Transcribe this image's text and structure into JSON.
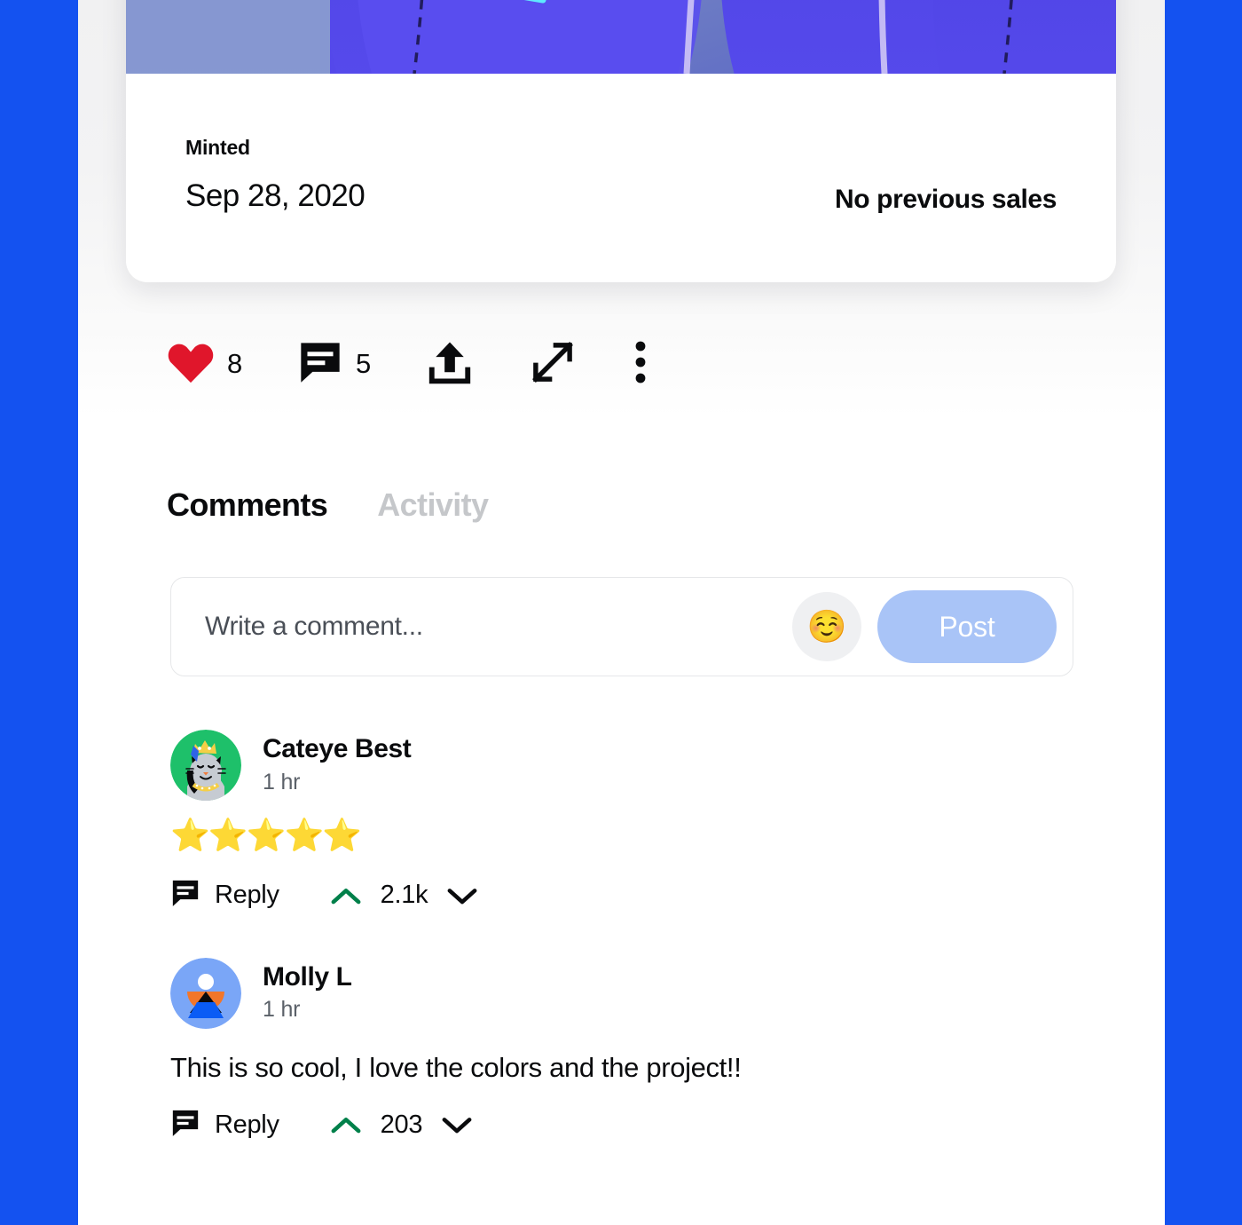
{
  "theme": {
    "page_background": "#1452f0",
    "card_background": "#ffffff",
    "text_primary": "#0a0b0d",
    "text_muted": "#5b6169",
    "tab_inactive": "#c5c7ca",
    "post_button": "#a9c4f7",
    "heart_red": "#e0162b",
    "upvote_green": "#00804a",
    "emoji_button_bg": "#eff0f2"
  },
  "asset_card": {
    "media": {
      "icon": "nft-artwork-image",
      "description": "Abstract blue and purple artwork with cyan lightning streaks"
    },
    "minted_label": "Minted",
    "minted_date": "Sep 28, 2020",
    "sales_note": "No previous sales"
  },
  "action_bar": {
    "items": [
      {
        "icon": "heart-icon",
        "count": "8",
        "name": "like-action"
      },
      {
        "icon": "comment-bubble-icon",
        "count": "5",
        "name": "comment-action"
      },
      {
        "icon": "share-upload-icon",
        "count": "",
        "name": "share-action"
      },
      {
        "icon": "expand-fullscreen-icon",
        "count": "",
        "name": "expand-action"
      },
      {
        "icon": "more-vertical-icon",
        "count": "",
        "name": "more-options-action"
      }
    ]
  },
  "tabs": [
    {
      "label": "Comments",
      "active": true
    },
    {
      "label": "Activity",
      "active": false
    }
  ],
  "composer": {
    "placeholder": "Write a comment...",
    "value": "",
    "emoji": "☺️",
    "post_label": "Post"
  },
  "comments": [
    {
      "author": "Cateye Best",
      "time": "1 hr",
      "avatar": "cat-with-crown-avatar",
      "body_type": "stars",
      "stars": "⭐⭐⭐⭐⭐",
      "text": "",
      "reply_label": "Reply",
      "vote_count": "2.1k"
    },
    {
      "author": "Molly L",
      "time": "1 hr",
      "avatar": "abstract-figure-avatar",
      "body_type": "text",
      "stars": "",
      "text": "This is so cool, I love the colors and the project!!",
      "reply_label": "Reply",
      "vote_count": "203"
    }
  ]
}
